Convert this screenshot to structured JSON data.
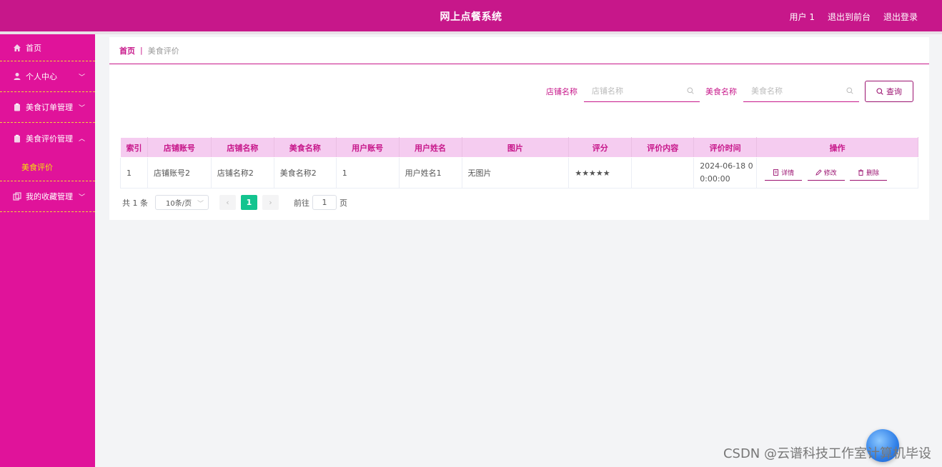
{
  "header": {
    "title": "网上点餐系统",
    "user": "用户 1",
    "to_front": "退出到前台",
    "logout": "退出登录"
  },
  "sidebar": {
    "items": [
      {
        "label": "首页",
        "icon": "home-icon"
      },
      {
        "label": "个人中心",
        "icon": "user-icon"
      },
      {
        "label": "美食订单管理",
        "icon": "clipboard-icon"
      },
      {
        "label": "美食评价管理",
        "icon": "clipboard-icon"
      },
      {
        "label": "美食评价",
        "icon": ""
      },
      {
        "label": "我的收藏管理",
        "icon": "copy-icon"
      }
    ]
  },
  "breadcrumb": {
    "home": "首页",
    "sep": "|",
    "current": "美食评价"
  },
  "search": {
    "shop_label": "店铺名称",
    "shop_placeholder": "店铺名称",
    "food_label": "美食名称",
    "food_placeholder": "美食名称",
    "query_button": "查询"
  },
  "table": {
    "headers": [
      "索引",
      "店铺账号",
      "店铺名称",
      "美食名称",
      "用户账号",
      "用户姓名",
      "图片",
      "评分",
      "评价内容",
      "评价时间",
      "操作"
    ],
    "rows": [
      {
        "index": "1",
        "shop_account": "店铺账号2",
        "shop_name": "店铺名称2",
        "food_name": "美食名称2",
        "user_account": "1",
        "user_name": "用户姓名1",
        "image": "无图片",
        "rating": "★★★★★",
        "content": "",
        "time_line1": "2024-06-18 0",
        "time_line2": "0:00:00",
        "ops": {
          "detail": "详情",
          "edit": "修改",
          "delete": "删除"
        }
      }
    ]
  },
  "pagination": {
    "total": "共 1 条",
    "page_size": "10条/页",
    "current_page": "1",
    "goto_label": "前往",
    "goto_value": "1",
    "page_suffix": "页"
  },
  "watermark": "CSDN @云谱科技工作室计算机毕设",
  "colors": {
    "primary": "#c7178a",
    "sidebar": "#e0139a",
    "accent": "#f5e10a",
    "table_header": "#f5ccf0",
    "pager_active": "#13c48f"
  }
}
